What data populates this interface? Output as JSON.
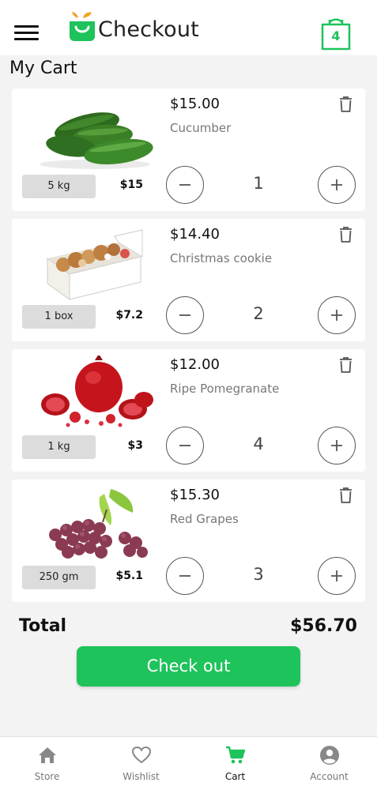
{
  "header": {
    "title": "Checkout",
    "cart_count": "4",
    "brand_color": "#1ec35b"
  },
  "page_title": "My Cart",
  "items": [
    {
      "price": "$15.00",
      "name": "Cucumber",
      "unit": "5 kg",
      "unit_price": "$15",
      "quantity": "1",
      "image": "cucumber"
    },
    {
      "price": "$14.40",
      "name": "Christmas cookie",
      "unit": "1 box",
      "unit_price": "$7.2",
      "quantity": "2",
      "image": "cookie-box"
    },
    {
      "price": "$12.00",
      "name": "Ripe Pomegranate",
      "unit": "1 kg",
      "unit_price": "$3",
      "quantity": "4",
      "image": "pomegranate"
    },
    {
      "price": "$15.30",
      "name": "Red Grapes",
      "unit": "250 gm",
      "unit_price": "$5.1",
      "quantity": "3",
      "image": "red-grapes"
    }
  ],
  "summary": {
    "total_label": "Total",
    "total_value": "$56.70",
    "checkout_label": "Check out"
  },
  "nav": [
    {
      "label": "Store",
      "icon": "home-icon"
    },
    {
      "label": "Wishlist",
      "icon": "heart-icon"
    },
    {
      "label": "Cart",
      "icon": "cart-icon",
      "active": true
    },
    {
      "label": "Account",
      "icon": "account-icon"
    }
  ]
}
